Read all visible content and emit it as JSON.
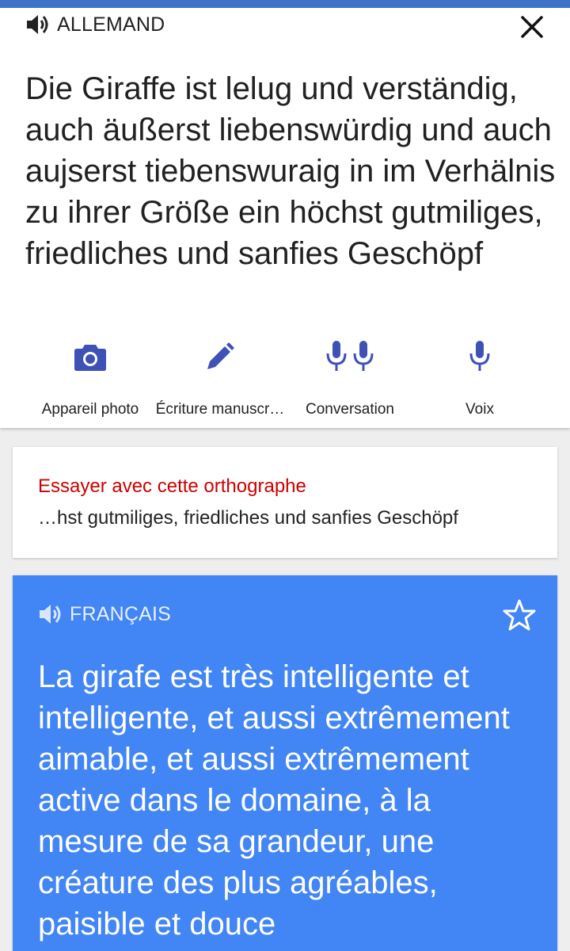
{
  "source": {
    "language_label": "ALLEMAND",
    "text": "Die Giraffe ist lelug und verständig, auch äußerst liebenswürdig und auch aujserst tiebenswuraig in im Verhälnis zu ihrer Größe ein höchst gutmiliges, friedliches und sanfies Geschöpf",
    "speaker_icon": "speaker-icon",
    "close_icon": "close-icon"
  },
  "tools": [
    {
      "label": "Appareil photo",
      "icon": "camera-icon"
    },
    {
      "label": "Écriture manuscr…",
      "icon": "pen-icon"
    },
    {
      "label": "Conversation",
      "icon": "conversation-mic-icon"
    },
    {
      "label": "Voix",
      "icon": "mic-icon"
    }
  ],
  "suggestion": {
    "title": "Essayer avec cette orthographe",
    "text": "…hst gutmiliges, friedliches und sanfies Geschöpf"
  },
  "result": {
    "language_label": "FRANÇAIS",
    "text": "La girafe est très intelligente et intelligente, et aussi extrêmement aimable, et aussi extrêmement active dans le domaine, à la mesure de sa grandeur, une créature des plus agréables, paisible et douce",
    "star_icon": "star-icon"
  },
  "colors": {
    "accent": "#3f51b5",
    "result_background": "#4285f4",
    "suggestion_title": "#cc0000",
    "top_bar": "#3d74c9"
  }
}
